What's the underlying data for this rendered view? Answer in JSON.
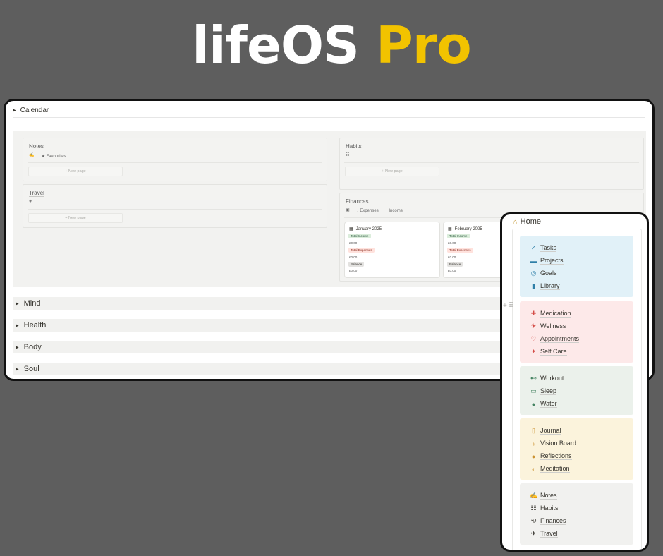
{
  "hero": {
    "word1": "lifeOS",
    "word2": "Pro"
  },
  "calendar": {
    "label": "Calendar"
  },
  "notes": {
    "title": "Notes",
    "tab_icon": "✍",
    "tab_fav": "★ Favourites",
    "new_page": "+ New page"
  },
  "travel": {
    "title": "Travel",
    "tab_icon": "✈",
    "new_page": "+ New page"
  },
  "habits": {
    "title": "Habits",
    "tab_icon": "☷",
    "new_page": "+ New page"
  },
  "finances": {
    "title": "Finances",
    "tab_icon": "▣",
    "tab_expenses": "↓ Expenses",
    "tab_income": "↑ Income",
    "cards": [
      {
        "month": "January 2025",
        "income_label": "Total Income",
        "income": "£0.00",
        "expense_label": "Total Expenses",
        "expense": "£0.00",
        "balance_label": "Balance",
        "balance": "£0.00"
      },
      {
        "month": "February 2025",
        "income_label": "Total Income",
        "income": "£0.00",
        "expense_label": "Total Expenses",
        "expense": "£0.00",
        "balance_label": "Balance",
        "balance": "£0.00"
      }
    ]
  },
  "sections": [
    "Mind",
    "Health",
    "Body",
    "Soul"
  ],
  "home": {
    "title": "Home",
    "groups": [
      {
        "items": [
          {
            "icon": "✓",
            "label": "Tasks"
          },
          {
            "icon": "▬",
            "label": "Projects"
          },
          {
            "icon": "◎",
            "label": "Goals"
          },
          {
            "icon": "▮",
            "label": "Library"
          }
        ]
      },
      {
        "items": [
          {
            "icon": "✚",
            "label": "Medication"
          },
          {
            "icon": "☀",
            "label": "Wellness"
          },
          {
            "icon": "♡",
            "label": "Appointments"
          },
          {
            "icon": "✦",
            "label": "Self Care"
          }
        ]
      },
      {
        "items": [
          {
            "icon": "⊷",
            "label": "Workout"
          },
          {
            "icon": "▭",
            "label": "Sleep"
          },
          {
            "icon": "●",
            "label": "Water"
          }
        ]
      },
      {
        "items": [
          {
            "icon": "▯",
            "label": "Journal"
          },
          {
            "icon": "♁",
            "label": "Vision Board"
          },
          {
            "icon": "●",
            "label": "Reflections"
          },
          {
            "icon": "◐",
            "label": "Meditation"
          }
        ]
      },
      {
        "items": [
          {
            "icon": "✍",
            "label": "Notes"
          },
          {
            "icon": "☷",
            "label": "Habits"
          },
          {
            "icon": "⟲",
            "label": "Finances"
          },
          {
            "icon": "✈",
            "label": "Travel"
          }
        ]
      }
    ],
    "colors": {
      "blue": "#e1f1f8",
      "red": "#fde9e9",
      "green": "#ebf1eb",
      "yellow": "#fbf3dc",
      "gray": "#f1f1ef"
    }
  }
}
